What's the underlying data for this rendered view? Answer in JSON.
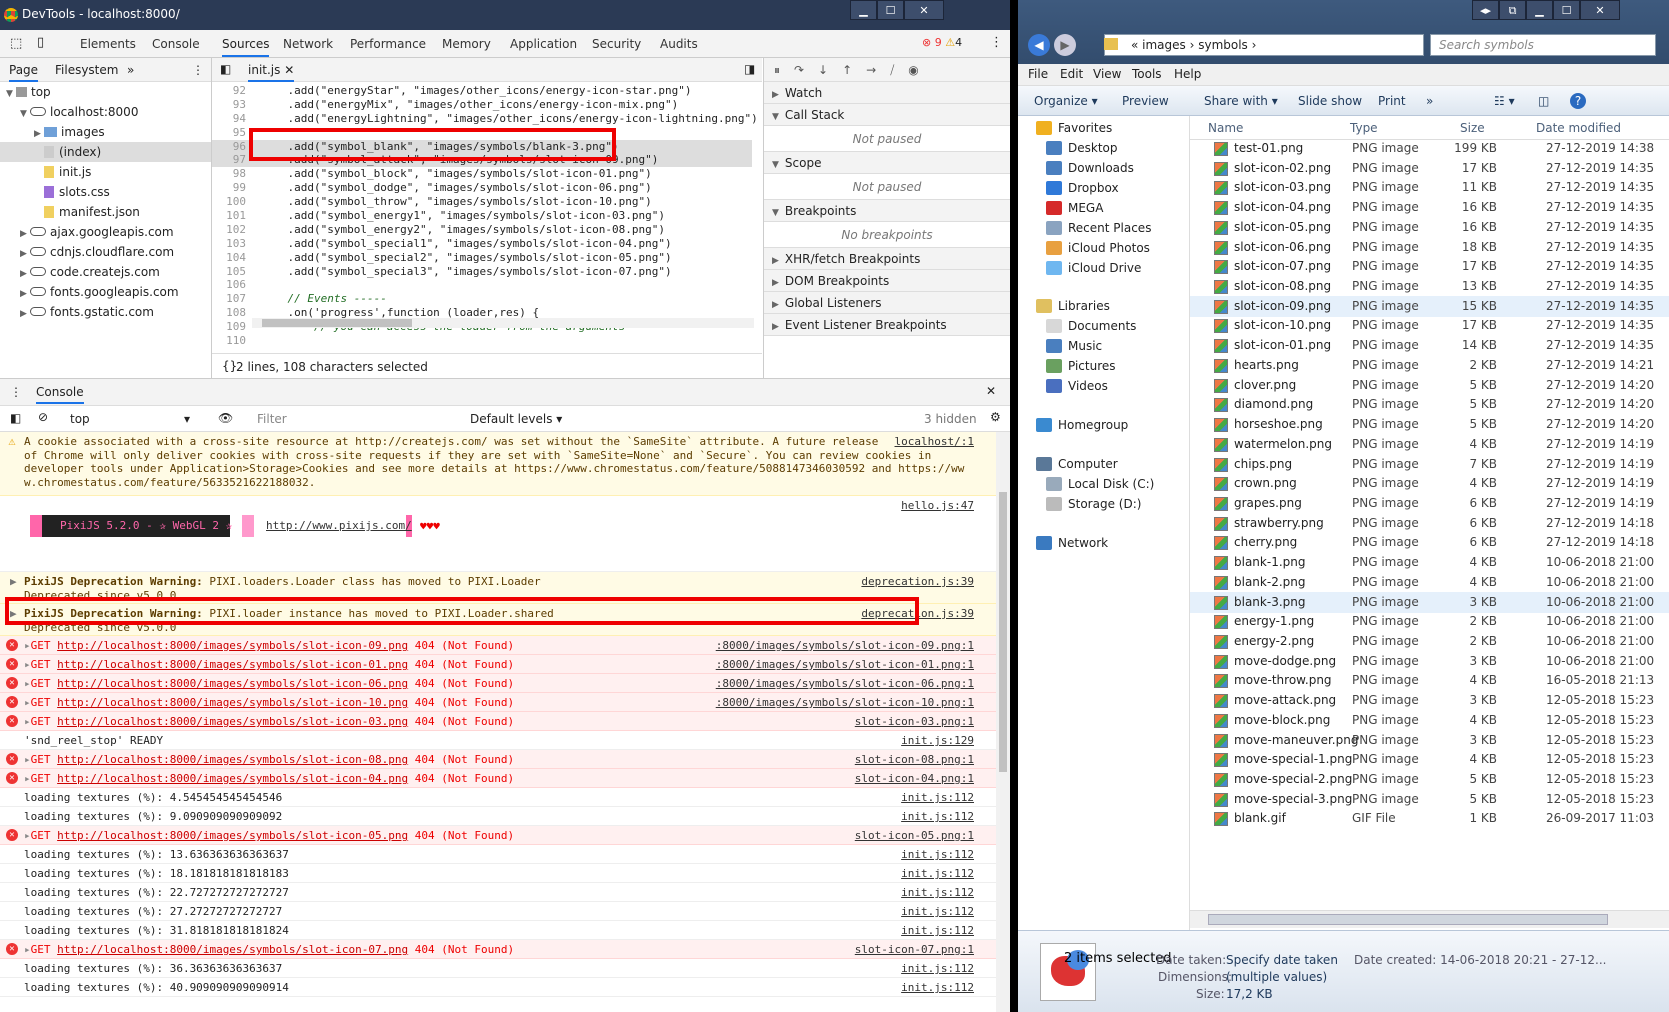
{
  "devtools": {
    "window_title": "DevTools - localhost:8000/",
    "tabs": [
      "Elements",
      "Console",
      "Sources",
      "Network",
      "Performance",
      "Memory",
      "Application",
      "Security",
      "Audits"
    ],
    "error_count": "9",
    "warning_count": "4",
    "nav_tabs": [
      "Page",
      "Filesystem",
      "»"
    ],
    "tree": [
      {
        "label": "top",
        "indent": 0,
        "kind": "top"
      },
      {
        "label": "localhost:8000",
        "indent": 1,
        "kind": "cloud"
      },
      {
        "label": "images",
        "indent": 2,
        "kind": "folder"
      },
      {
        "label": "(index)",
        "indent": 2,
        "kind": "file-g",
        "selected": true
      },
      {
        "label": "init.js",
        "indent": 2,
        "kind": "file"
      },
      {
        "label": "slots.css",
        "indent": 2,
        "kind": "file-p"
      },
      {
        "label": "manifest.json",
        "indent": 2,
        "kind": "file"
      },
      {
        "label": "ajax.googleapis.com",
        "indent": 1,
        "kind": "cloud"
      },
      {
        "label": "cdnjs.cloudflare.com",
        "indent": 1,
        "kind": "cloud"
      },
      {
        "label": "code.createjs.com",
        "indent": 1,
        "kind": "cloud"
      },
      {
        "label": "fonts.googleapis.com",
        "indent": 1,
        "kind": "cloud"
      },
      {
        "label": "fonts.gstatic.com",
        "indent": 1,
        "kind": "cloud"
      }
    ],
    "editor_tab": "init.js",
    "code_lines": [
      {
        "n": "92",
        "t": "    .add(\"energyStar\", \"images/other_icons/energy-icon-star.png\")"
      },
      {
        "n": "93",
        "t": "    .add(\"energyMix\", \"images/other_icons/energy-icon-mix.png\")"
      },
      {
        "n": "94",
        "t": "    .add(\"energyLightning\", \"images/other_icons/energy-icon-lightning.png\")"
      },
      {
        "n": "95",
        "t": ""
      },
      {
        "n": "96",
        "t": "    .add(\"symbol_blank\", \"images/symbols/blank-3.png\")",
        "hl": true
      },
      {
        "n": "97",
        "t": "    .add(\"symbol_attack\", \"images/symbols/slot-icon-09.png\")",
        "hl": true
      },
      {
        "n": "98",
        "t": "    .add(\"symbol_block\", \"images/symbols/slot-icon-01.png\")"
      },
      {
        "n": "99",
        "t": "    .add(\"symbol_dodge\", \"images/symbols/slot-icon-06.png\")"
      },
      {
        "n": "100",
        "t": "    .add(\"symbol_throw\", \"images/symbols/slot-icon-10.png\")"
      },
      {
        "n": "101",
        "t": "    .add(\"symbol_energy1\", \"images/symbols/slot-icon-03.png\")"
      },
      {
        "n": "102",
        "t": "    .add(\"symbol_energy2\", \"images/symbols/slot-icon-08.png\")"
      },
      {
        "n": "103",
        "t": "    .add(\"symbol_special1\", \"images/symbols/slot-icon-04.png\")"
      },
      {
        "n": "104",
        "t": "    .add(\"symbol_special2\", \"images/symbols/slot-icon-05.png\")"
      },
      {
        "n": "105",
        "t": "    .add(\"symbol_special3\", \"images/symbols/slot-icon-07.png\")"
      },
      {
        "n": "106",
        "t": ""
      },
      {
        "n": "107",
        "t": "    // Events -----",
        "cm": true
      },
      {
        "n": "108",
        "t": "    .on('progress',function (loader,res) {"
      },
      {
        "n": "109",
        "t": "        // you can access the loader from the arguments",
        "cm": true
      },
      {
        "n": "110",
        "t": ""
      }
    ],
    "status_text": "2 lines, 108 characters selected",
    "debug_sections": [
      {
        "label": "Watch",
        "open": false
      },
      {
        "label": "Call Stack",
        "open": true,
        "note": "Not paused"
      },
      {
        "label": "Scope",
        "open": true,
        "note": "Not paused"
      },
      {
        "label": "Breakpoints",
        "open": true,
        "note": "No breakpoints"
      },
      {
        "label": "XHR/fetch Breakpoints",
        "open": false
      },
      {
        "label": "DOM Breakpoints",
        "open": false
      },
      {
        "label": "Global Listeners",
        "open": false
      },
      {
        "label": "Event Listener Breakpoints",
        "open": false
      }
    ],
    "console_tab": "Console",
    "context": "top",
    "filter_placeholder": "Filter",
    "levels": "Default levels ▾",
    "hidden": "3 hidden",
    "cookie_warning": [
      "A cookie associated with a cross-site resource at http://createjs.com/ was set without the `SameSite` attribute. A future release",
      "of Chrome will only deliver cookies with cross-site requests if they are set with `SameSite=None` and `Secure`. You can review cookies in",
      "developer tools under Application>Storage>Cookies and see more details at https://www.chromestatus.com/feature/5088147346030592 and https://ww",
      "w.chromestatus.com/feature/5633521622188032."
    ],
    "cookie_src": "localhost/:1",
    "pixi_banner": "PixiJS 5.2.0 - ✰ WebGL 2 ✰",
    "pixi_url": "http://www.pixijs.com/",
    "pixi_hearts": "♥♥♥",
    "pixi_src": "hello.js:47",
    "deprecations": [
      {
        "b": "PixiJS Deprecation Warning:",
        "t": " PIXI.loaders.Loader class has moved to PIXI.Loader",
        "t2": "Deprecated since v5.0.0",
        "src": "deprecation.js:39"
      },
      {
        "b": "PixiJS Deprecation Warning:",
        "t": " PIXI.loader instance has moved to PIXI.Loader.shared",
        "t2": "Deprecated since v5.0.0",
        "src": "deprecation.js:39"
      }
    ],
    "logs": [
      {
        "k": "error",
        "url": "http://localhost:8000/images/symbols/slot-icon-09.png",
        "st": "404 (Not Found)",
        "src": ":8000/images/symbols/slot-icon-09.png:1"
      },
      {
        "k": "error",
        "url": "http://localhost:8000/images/symbols/slot-icon-01.png",
        "st": "404 (Not Found)",
        "src": ":8000/images/symbols/slot-icon-01.png:1"
      },
      {
        "k": "error",
        "url": "http://localhost:8000/images/symbols/slot-icon-06.png",
        "st": "404 (Not Found)",
        "src": ":8000/images/symbols/slot-icon-06.png:1"
      },
      {
        "k": "error",
        "url": "http://localhost:8000/images/symbols/slot-icon-10.png",
        "st": "404 (Not Found)",
        "src": ":8000/images/symbols/slot-icon-10.png:1"
      },
      {
        "k": "error",
        "url": "http://localhost:8000/images/symbols/slot-icon-03.png",
        "st": "404 (Not Found)",
        "src": "slot-icon-03.png:1"
      },
      {
        "k": "log",
        "text": "'snd_reel_stop' READY",
        "src": "init.js:129"
      },
      {
        "k": "error",
        "url": "http://localhost:8000/images/symbols/slot-icon-08.png",
        "st": "404 (Not Found)",
        "src": "slot-icon-08.png:1"
      },
      {
        "k": "error",
        "url": "http://localhost:8000/images/symbols/slot-icon-04.png",
        "st": "404 (Not Found)",
        "src": "slot-icon-04.png:1"
      },
      {
        "k": "log",
        "text": "loading textures (%): 4.545454545454546",
        "src": "init.js:112"
      },
      {
        "k": "log",
        "text": "loading textures (%): 9.090909090909092",
        "src": "init.js:112"
      },
      {
        "k": "error",
        "url": "http://localhost:8000/images/symbols/slot-icon-05.png",
        "st": "404 (Not Found)",
        "src": "slot-icon-05.png:1"
      },
      {
        "k": "log",
        "text": "loading textures (%): 13.636363636363637",
        "src": "init.js:112"
      },
      {
        "k": "log",
        "text": "loading textures (%): 18.181818181818183",
        "src": "init.js:112"
      },
      {
        "k": "log",
        "text": "loading textures (%): 22.727272727272727",
        "src": "init.js:112"
      },
      {
        "k": "log",
        "text": "loading textures (%): 27.27272727272727",
        "src": "init.js:112"
      },
      {
        "k": "log",
        "text": "loading textures (%): 31.818181818181824",
        "src": "init.js:112"
      },
      {
        "k": "error",
        "url": "http://localhost:8000/images/symbols/slot-icon-07.png",
        "st": "404 (Not Found)",
        "src": "slot-icon-07.png:1"
      },
      {
        "k": "log",
        "text": "loading textures (%): 36.36363636363637",
        "src": "init.js:112"
      },
      {
        "k": "log",
        "text": "loading textures (%): 40.909090909090914",
        "src": "init.js:112"
      }
    ]
  },
  "explorer": {
    "breadcrumb": "« images  ›  symbols  ›",
    "search_placeholder": "Search symbols",
    "menu": [
      "File",
      "Edit",
      "View",
      "Tools",
      "Help"
    ],
    "toolbar": [
      "Organize ▾",
      "Preview",
      "Share with ▾",
      "Slide show",
      "Print",
      "»"
    ],
    "nav": [
      {
        "label": "Favorites",
        "c": "#f0b020",
        "x": 18
      },
      {
        "label": "Desktop",
        "c": "#4a7fbf",
        "x": 28
      },
      {
        "label": "Downloads",
        "c": "#4a7fbf",
        "x": 28
      },
      {
        "label": "Dropbox",
        "c": "#2f79d8",
        "x": 28
      },
      {
        "label": "MEGA",
        "c": "#d52a2a",
        "x": 28
      },
      {
        "label": "Recent Places",
        "c": "#8aa3c0",
        "x": 28
      },
      {
        "label": "iCloud Photos",
        "c": "#e8a040",
        "x": 28
      },
      {
        "label": "iCloud Drive",
        "c": "#6fb7f0",
        "x": 28
      },
      {
        "label": "Libraries",
        "c": "#e0c060",
        "x": 18
      },
      {
        "label": "Documents",
        "c": "#d8d8d8",
        "x": 28
      },
      {
        "label": "Music",
        "c": "#4a7fbf",
        "x": 28
      },
      {
        "label": "Pictures",
        "c": "#6aa060",
        "x": 28
      },
      {
        "label": "Videos",
        "c": "#4a6fbf",
        "x": 28
      },
      {
        "label": "Homegroup",
        "c": "#3a8ad0",
        "x": 18
      },
      {
        "label": "Computer",
        "c": "#5a7898",
        "x": 18
      },
      {
        "label": "Local Disk (C:)",
        "c": "#9ab",
        "x": 28
      },
      {
        "label": "Storage (D:)",
        "c": "#bbb",
        "x": 28
      },
      {
        "label": "Network",
        "c": "#3a7ac0",
        "x": 18
      }
    ],
    "columns": [
      "Name",
      "Type",
      "Size",
      "Date modified"
    ],
    "files": [
      [
        "test-01.png",
        "PNG image",
        "199 KB",
        "27-12-2019 14:38"
      ],
      [
        "slot-icon-02.png",
        "PNG image",
        "17 KB",
        "27-12-2019 14:35"
      ],
      [
        "slot-icon-03.png",
        "PNG image",
        "11 KB",
        "27-12-2019 14:35"
      ],
      [
        "slot-icon-04.png",
        "PNG image",
        "16 KB",
        "27-12-2019 14:35"
      ],
      [
        "slot-icon-05.png",
        "PNG image",
        "16 KB",
        "27-12-2019 14:35"
      ],
      [
        "slot-icon-06.png",
        "PNG image",
        "18 KB",
        "27-12-2019 14:35"
      ],
      [
        "slot-icon-07.png",
        "PNG image",
        "17 KB",
        "27-12-2019 14:35"
      ],
      [
        "slot-icon-08.png",
        "PNG image",
        "13 KB",
        "27-12-2019 14:35"
      ],
      [
        "slot-icon-09.png",
        "PNG image",
        "15 KB",
        "27-12-2019 14:35"
      ],
      [
        "slot-icon-10.png",
        "PNG image",
        "17 KB",
        "27-12-2019 14:35"
      ],
      [
        "slot-icon-01.png",
        "PNG image",
        "14 KB",
        "27-12-2019 14:35"
      ],
      [
        "hearts.png",
        "PNG image",
        "2 KB",
        "27-12-2019 14:21"
      ],
      [
        "clover.png",
        "PNG image",
        "5 KB",
        "27-12-2019 14:20"
      ],
      [
        "diamond.png",
        "PNG image",
        "5 KB",
        "27-12-2019 14:20"
      ],
      [
        "horseshoe.png",
        "PNG image",
        "5 KB",
        "27-12-2019 14:20"
      ],
      [
        "watermelon.png",
        "PNG image",
        "4 KB",
        "27-12-2019 14:19"
      ],
      [
        "chips.png",
        "PNG image",
        "7 KB",
        "27-12-2019 14:19"
      ],
      [
        "crown.png",
        "PNG image",
        "4 KB",
        "27-12-2019 14:19"
      ],
      [
        "grapes.png",
        "PNG image",
        "6 KB",
        "27-12-2019 14:19"
      ],
      [
        "strawberry.png",
        "PNG image",
        "6 KB",
        "27-12-2019 14:18"
      ],
      [
        "cherry.png",
        "PNG image",
        "6 KB",
        "27-12-2019 14:18"
      ],
      [
        "blank-1.png",
        "PNG image",
        "4 KB",
        "10-06-2018 21:00"
      ],
      [
        "blank-2.png",
        "PNG image",
        "4 KB",
        "10-06-2018 21:00"
      ],
      [
        "blank-3.png",
        "PNG image",
        "3 KB",
        "10-06-2018 21:00"
      ],
      [
        "energy-1.png",
        "PNG image",
        "2 KB",
        "10-06-2018 21:00"
      ],
      [
        "energy-2.png",
        "PNG image",
        "2 KB",
        "10-06-2018 21:00"
      ],
      [
        "move-dodge.png",
        "PNG image",
        "3 KB",
        "10-06-2018 21:00"
      ],
      [
        "move-throw.png",
        "PNG image",
        "4 KB",
        "16-05-2018 21:13"
      ],
      [
        "move-attack.png",
        "PNG image",
        "3 KB",
        "12-05-2018 15:23"
      ],
      [
        "move-block.png",
        "PNG image",
        "4 KB",
        "12-05-2018 15:23"
      ],
      [
        "move-maneuver.png",
        "PNG image",
        "3 KB",
        "12-05-2018 15:23"
      ],
      [
        "move-special-1.png",
        "PNG image",
        "4 KB",
        "12-05-2018 15:23"
      ],
      [
        "move-special-2.png",
        "PNG image",
        "5 KB",
        "12-05-2018 15:23"
      ],
      [
        "move-special-3.png",
        "PNG image",
        "5 KB",
        "12-05-2018 15:23"
      ],
      [
        "blank.gif",
        "GIF File",
        "1 KB",
        "26-09-2017 11:03"
      ]
    ],
    "selected_files": [
      "slot-icon-09.png",
      "blank-3.png"
    ],
    "details": {
      "count": "2 items selected",
      "taken_label": "Date taken:",
      "taken_value": "Specify date taken",
      "dims_label": "Dimensions:",
      "dims_value": "(multiple values)",
      "size_label": "Size:",
      "size_value": "17,2 KB",
      "created": "Date created:  14-06-2018 20:21 - 27-12..."
    }
  }
}
